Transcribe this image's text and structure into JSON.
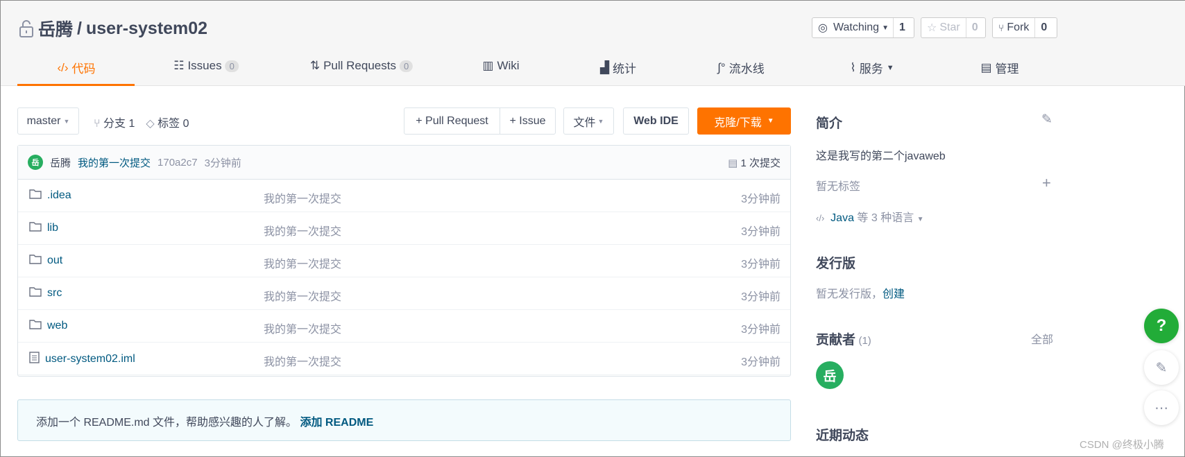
{
  "repo": {
    "owner": "岳腾",
    "separator": "/",
    "name": "user-system02"
  },
  "social": {
    "watch_label": "Watching",
    "watch_count": "1",
    "star_label": "Star",
    "star_count": "0",
    "fork_label": "Fork",
    "fork_count": "0"
  },
  "tabs": [
    {
      "label": "代码",
      "active": true
    },
    {
      "label": "Issues",
      "count": "0"
    },
    {
      "label": "Pull Requests",
      "count": "0"
    },
    {
      "label": "Wiki"
    },
    {
      "label": "统计"
    },
    {
      "label": "流水线"
    },
    {
      "label": "服务"
    },
    {
      "label": "管理"
    }
  ],
  "toolbar": {
    "branch": "master",
    "branches": "分支 1",
    "tags": "标签 0",
    "pull_request": "+ Pull Request",
    "issue": "+ Issue",
    "file": "文件",
    "web_ide": "Web IDE",
    "clone": "克隆/下载"
  },
  "commit": {
    "avatar": "岳",
    "author": "岳腾",
    "message": "我的第一次提交",
    "hash": "170a2c7",
    "time": "3分钟前",
    "count": "1 次提交"
  },
  "files": [
    {
      "name": ".idea",
      "type": "folder",
      "message": "我的第一次提交",
      "time": "3分钟前"
    },
    {
      "name": "lib",
      "type": "folder",
      "message": "我的第一次提交",
      "time": "3分钟前"
    },
    {
      "name": "out",
      "type": "folder",
      "message": "我的第一次提交",
      "time": "3分钟前"
    },
    {
      "name": "src",
      "type": "folder",
      "message": "我的第一次提交",
      "time": "3分钟前"
    },
    {
      "name": "web",
      "type": "folder",
      "message": "我的第一次提交",
      "time": "3分钟前"
    },
    {
      "name": "user-system02.iml",
      "type": "file",
      "message": "我的第一次提交",
      "time": "3分钟前"
    }
  ],
  "readme": {
    "text": "添加一个 README.md 文件，帮助感兴趣的人了解。",
    "link": "添加 README"
  },
  "sidebar": {
    "intro_title": "简介",
    "description": "这是我写的第二个javaweb",
    "no_tags": "暂无标签",
    "lang_main": "Java",
    "lang_rest": "等 3 种语言",
    "release_title": "发行版",
    "no_release": "暂无发行版，",
    "create": "创建",
    "contrib_title": "贡献者",
    "contrib_count": "(1)",
    "all": "全部",
    "contrib_avatar": "岳",
    "activity_title": "近期动态"
  },
  "watermark": "CSDN @终极小腾",
  "colors": {
    "accent": "#fe7300",
    "link": "#005980",
    "avatar": "#27ae60",
    "help": "#22ac38"
  }
}
